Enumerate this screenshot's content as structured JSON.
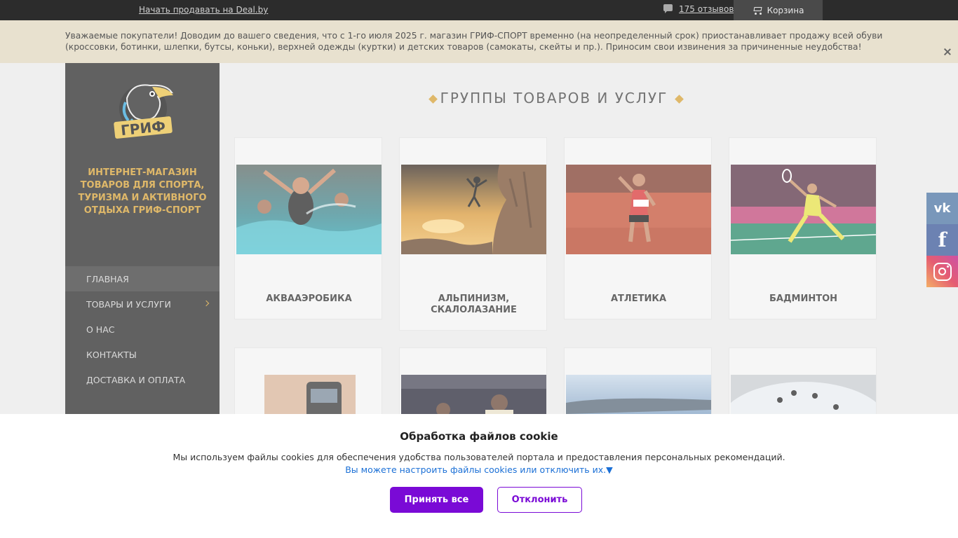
{
  "topbar": {
    "sell_link": "Начать продавать на Deal.by",
    "reviews": "175 отзывов",
    "cart": "Корзина"
  },
  "notice": {
    "text": "Уважаемые покупатели! Доводим до вашего сведения, что с 1-го июля 2025 г. магазин ГРИФ-СПОРТ временно (на неопределенный срок) приостанавливает продажу всей обуви (кроссовки, ботинки, шлепки, бутсы, коньки), верхней одежды (куртки) и детских товаров (самокаты, скейты и пр.). Приносим свои извинения за причиненные неудобства!"
  },
  "sidebar": {
    "logo_text": "ГРИФ",
    "shop_title": "Интернет-магазин товаров для спорта, туризма и активного отдыха ГРИФ-СПОРТ",
    "nav": [
      {
        "label": "ГЛАВНАЯ"
      },
      {
        "label": "ТОВАРЫ И УСЛУГИ"
      },
      {
        "label": "О НАС"
      },
      {
        "label": "КОНТАКТЫ"
      },
      {
        "label": "ДОСТАВКА И ОПЛАТА"
      }
    ]
  },
  "main": {
    "section_title": "ГРУППЫ ТОВАРОВ И УСЛУГ",
    "cards": [
      {
        "label": "АКВААЭРОБИКА"
      },
      {
        "label": "АЛЬПИНИЗМ, СКАЛОЛАЗАНИЕ"
      },
      {
        "label": "АТЛЕТИКА"
      },
      {
        "label": "БАДМИНТОН"
      },
      {
        "label": ""
      },
      {
        "label": ""
      },
      {
        "label": ""
      },
      {
        "label": ""
      }
    ]
  },
  "social": {
    "vk": "vk",
    "fb": "f"
  },
  "cookie": {
    "title": "Обработка файлов cookie",
    "desc": "Мы используем файлы cookies для обеспечения удобства пользователей портала и предоставления персональных рекомендаций.",
    "settings": "Вы можете настроить файлы cookies или отключить их.▼",
    "accept": "Принять все",
    "decline": "Отклонить"
  },
  "colors": {
    "accent": "#d4a037",
    "cookie_button": "#7a0ad6",
    "sidebar_bg": "#2d2d2d"
  }
}
